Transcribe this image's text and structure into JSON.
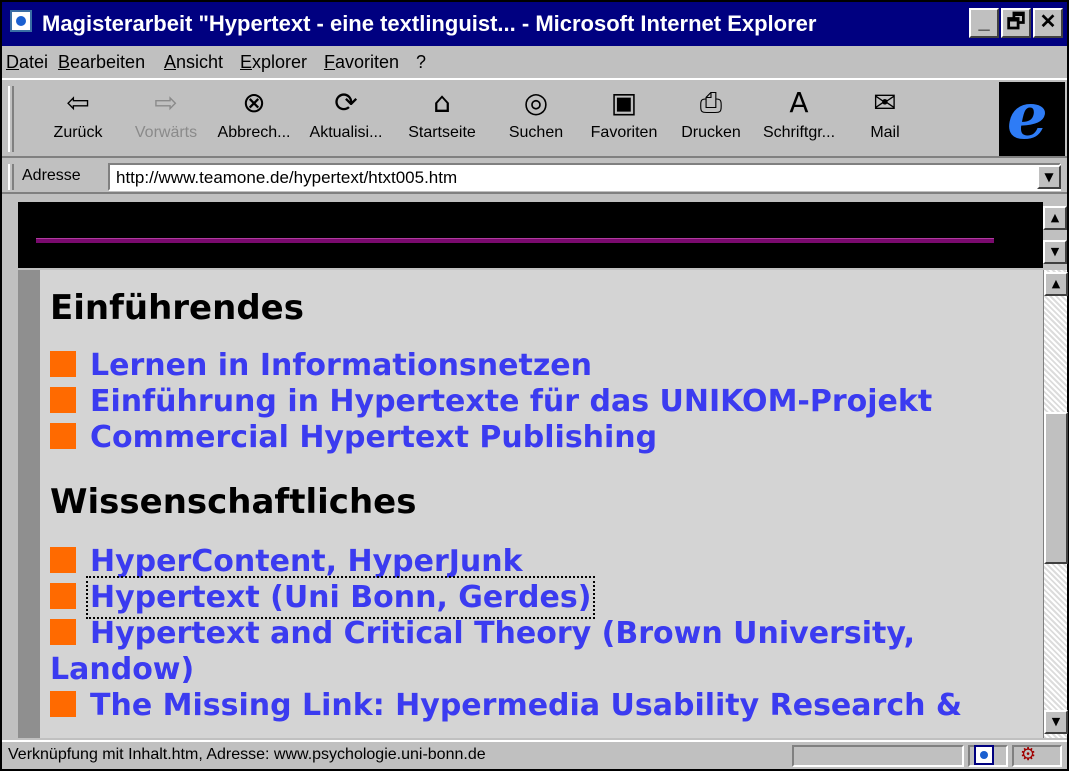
{
  "window": {
    "title": "Magisterarbeit \"Hypertext - eine textlinguist... - Microsoft Internet Explorer",
    "controls": [
      "_",
      "🗗",
      "✕"
    ]
  },
  "menu": [
    "Datei",
    "Bearbeiten",
    "Ansicht",
    "Explorer",
    "Favoriten",
    "?"
  ],
  "toolbar": {
    "buttons": [
      {
        "icon": "back-arrow-icon",
        "label": "Zurück",
        "enabled": true
      },
      {
        "icon": "forward-arrow-icon",
        "label": "Vorwärts",
        "enabled": false
      },
      {
        "icon": "stop-icon",
        "label": "Abbrech...",
        "enabled": true
      },
      {
        "icon": "refresh-icon",
        "label": "Aktualisi...",
        "enabled": true
      },
      {
        "icon": "home-icon",
        "label": "Startseite",
        "enabled": true
      },
      {
        "icon": "search-icon",
        "label": "Suchen",
        "enabled": true
      },
      {
        "icon": "favorites-icon",
        "label": "Favoriten",
        "enabled": true
      },
      {
        "icon": "print-icon",
        "label": "Drucken",
        "enabled": true
      },
      {
        "icon": "font-icon",
        "label": "Schriftgr...",
        "enabled": true
      },
      {
        "icon": "mail-icon",
        "label": "Mail",
        "enabled": true
      }
    ]
  },
  "address": {
    "label": "Adresse",
    "value": "http://www.teamone.de/hypertext/htxt005.htm"
  },
  "content": {
    "section1_heading": "Einführendes",
    "section1_links": [
      "Lernen in Informationsnetzen",
      "Einführung in Hypertexte für das UNIKOM-Projekt",
      "Commercial Hypertext Publishing"
    ],
    "section2_heading": "Wissenschaftliches",
    "section2_links": [
      "HyperContent, HyperJunk",
      "Hypertext (Uni Bonn, Gerdes)",
      "Hypertext and Critical Theory (Brown University,",
      "Landow)",
      "The Missing Link: Hypermedia Usability Research &"
    ]
  },
  "status": {
    "text": "Verknüpfung mit Inhalt.htm, Adresse: www.psychologie.uni-bonn.de"
  },
  "colors": {
    "titlebar": "#000080",
    "link": "#3b3bf0",
    "bullet": "#ff6a00",
    "divider_line": "#7a0a6e"
  }
}
